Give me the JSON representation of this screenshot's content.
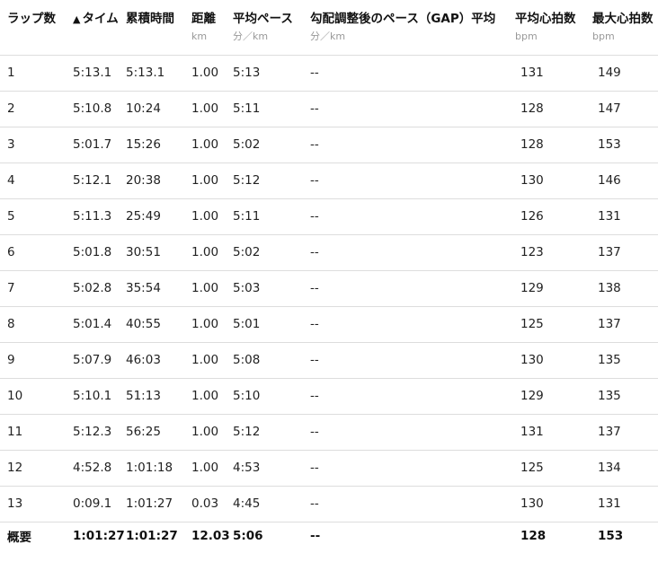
{
  "columns": [
    {
      "label": "ラップ数",
      "unit": ""
    },
    {
      "label": "タイム",
      "unit": "",
      "sort_indicator": "▲"
    },
    {
      "label": "累積時間",
      "unit": ""
    },
    {
      "label": "距離",
      "unit": "km"
    },
    {
      "label": "平均ペース",
      "unit": "分／km"
    },
    {
      "label": "勾配調整後のペース（GAP）平均",
      "unit": "分／km"
    },
    {
      "label": "平均心拍数",
      "unit": "bpm"
    },
    {
      "label": "最大心拍数",
      "unit": "bpm"
    }
  ],
  "rows": [
    [
      "1",
      "5:13.1",
      "5:13.1",
      "1.00",
      "5:13",
      "--",
      "131",
      "149"
    ],
    [
      "2",
      "5:10.8",
      "10:24",
      "1.00",
      "5:11",
      "--",
      "128",
      "147"
    ],
    [
      "3",
      "5:01.7",
      "15:26",
      "1.00",
      "5:02",
      "--",
      "128",
      "153"
    ],
    [
      "4",
      "5:12.1",
      "20:38",
      "1.00",
      "5:12",
      "--",
      "130",
      "146"
    ],
    [
      "5",
      "5:11.3",
      "25:49",
      "1.00",
      "5:11",
      "--",
      "126",
      "131"
    ],
    [
      "6",
      "5:01.8",
      "30:51",
      "1.00",
      "5:02",
      "--",
      "123",
      "137"
    ],
    [
      "7",
      "5:02.8",
      "35:54",
      "1.00",
      "5:03",
      "--",
      "129",
      "138"
    ],
    [
      "8",
      "5:01.4",
      "40:55",
      "1.00",
      "5:01",
      "--",
      "125",
      "137"
    ],
    [
      "9",
      "5:07.9",
      "46:03",
      "1.00",
      "5:08",
      "--",
      "130",
      "135"
    ],
    [
      "10",
      "5:10.1",
      "51:13",
      "1.00",
      "5:10",
      "--",
      "129",
      "135"
    ],
    [
      "11",
      "5:12.3",
      "56:25",
      "1.00",
      "5:12",
      "--",
      "131",
      "137"
    ],
    [
      "12",
      "4:52.8",
      "1:01:18",
      "1.00",
      "4:53",
      "--",
      "125",
      "134"
    ],
    [
      "13",
      "0:09.1",
      "1:01:27",
      "0.03",
      "4:45",
      "--",
      "130",
      "131"
    ]
  ],
  "summary": [
    "概要",
    "1:01:27",
    "1:01:27",
    "12.03",
    "5:06",
    "--",
    "128",
    "153"
  ]
}
